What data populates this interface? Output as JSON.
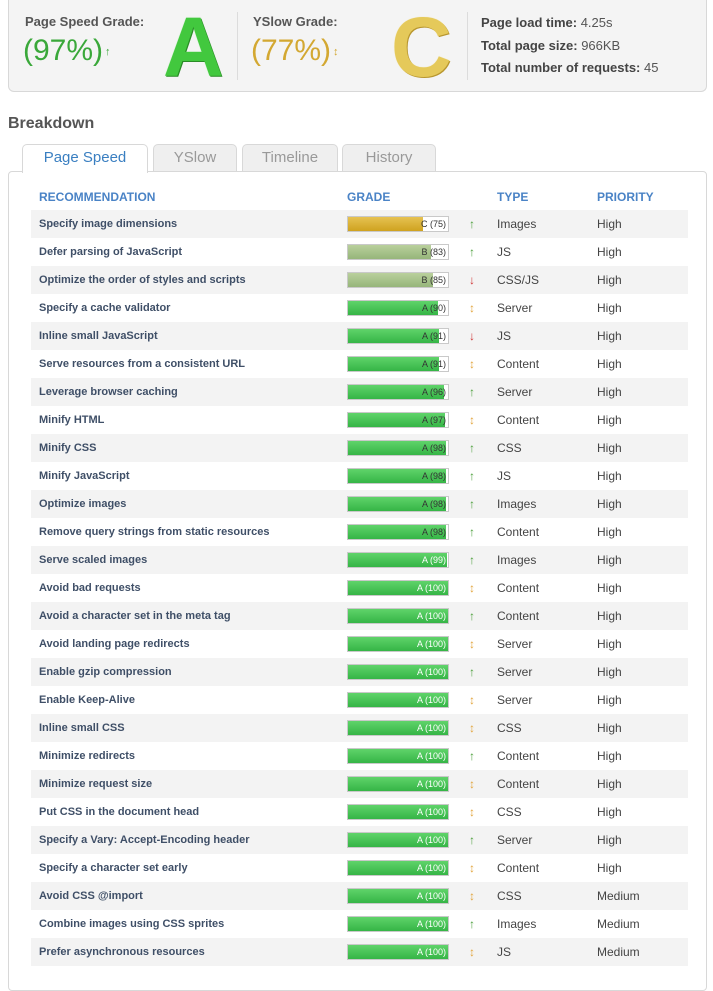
{
  "summary": {
    "pagespeed": {
      "label": "Page Speed Grade:",
      "percent": "(97%)",
      "trend": "↑",
      "letter": "A"
    },
    "yslow": {
      "label": "YSlow Grade:",
      "percent": "(77%)",
      "trend": "↕",
      "letter": "C"
    },
    "stats": [
      {
        "label": "Page load time:",
        "value": "4.25s"
      },
      {
        "label": "Total page size:",
        "value": "966KB"
      },
      {
        "label": "Total number of requests:",
        "value": "45"
      }
    ]
  },
  "breakdown": {
    "title": "Breakdown",
    "tabs": [
      "Page Speed",
      "YSlow",
      "Timeline",
      "History"
    ],
    "active_tab": 0,
    "headers": {
      "recommendation": "RECOMMENDATION",
      "grade": "GRADE",
      "type": "TYPE",
      "priority": "PRIORITY"
    },
    "rows": [
      {
        "rec": "Specify image dimensions",
        "letter": "C",
        "score": 75,
        "trend": "up",
        "type": "Images",
        "priority": "High"
      },
      {
        "rec": "Defer parsing of JavaScript",
        "letter": "B",
        "score": 83,
        "trend": "up",
        "type": "JS",
        "priority": "High"
      },
      {
        "rec": "Optimize the order of styles and scripts",
        "letter": "B",
        "score": 85,
        "trend": "down",
        "type": "CSS/JS",
        "priority": "High"
      },
      {
        "rec": "Specify a cache validator",
        "letter": "A",
        "score": 90,
        "trend": "updown",
        "type": "Server",
        "priority": "High"
      },
      {
        "rec": "Inline small JavaScript",
        "letter": "A",
        "score": 91,
        "trend": "down",
        "type": "JS",
        "priority": "High"
      },
      {
        "rec": "Serve resources from a consistent URL",
        "letter": "A",
        "score": 91,
        "trend": "updown",
        "type": "Content",
        "priority": "High"
      },
      {
        "rec": "Leverage browser caching",
        "letter": "A",
        "score": 96,
        "trend": "up",
        "type": "Server",
        "priority": "High"
      },
      {
        "rec": "Minify HTML",
        "letter": "A",
        "score": 97,
        "trend": "updown",
        "type": "Content",
        "priority": "High"
      },
      {
        "rec": "Minify CSS",
        "letter": "A",
        "score": 98,
        "trend": "up",
        "type": "CSS",
        "priority": "High"
      },
      {
        "rec": "Minify JavaScript",
        "letter": "A",
        "score": 98,
        "trend": "up",
        "type": "JS",
        "priority": "High"
      },
      {
        "rec": "Optimize images",
        "letter": "A",
        "score": 98,
        "trend": "up",
        "type": "Images",
        "priority": "High"
      },
      {
        "rec": "Remove query strings from static resources",
        "letter": "A",
        "score": 98,
        "trend": "up",
        "type": "Content",
        "priority": "High"
      },
      {
        "rec": "Serve scaled images",
        "letter": "A",
        "score": 99,
        "trend": "up",
        "type": "Images",
        "priority": "High"
      },
      {
        "rec": "Avoid bad requests",
        "letter": "A",
        "score": 100,
        "trend": "updown",
        "type": "Content",
        "priority": "High"
      },
      {
        "rec": "Avoid a character set in the meta tag",
        "letter": "A",
        "score": 100,
        "trend": "up",
        "type": "Content",
        "priority": "High"
      },
      {
        "rec": "Avoid landing page redirects",
        "letter": "A",
        "score": 100,
        "trend": "updown",
        "type": "Server",
        "priority": "High"
      },
      {
        "rec": "Enable gzip compression",
        "letter": "A",
        "score": 100,
        "trend": "up",
        "type": "Server",
        "priority": "High"
      },
      {
        "rec": "Enable Keep-Alive",
        "letter": "A",
        "score": 100,
        "trend": "updown",
        "type": "Server",
        "priority": "High"
      },
      {
        "rec": "Inline small CSS",
        "letter": "A",
        "score": 100,
        "trend": "updown",
        "type": "CSS",
        "priority": "High"
      },
      {
        "rec": "Minimize redirects",
        "letter": "A",
        "score": 100,
        "trend": "up",
        "type": "Content",
        "priority": "High"
      },
      {
        "rec": "Minimize request size",
        "letter": "A",
        "score": 100,
        "trend": "updown",
        "type": "Content",
        "priority": "High"
      },
      {
        "rec": "Put CSS in the document head",
        "letter": "A",
        "score": 100,
        "trend": "updown",
        "type": "CSS",
        "priority": "High"
      },
      {
        "rec": "Specify a Vary: Accept-Encoding header",
        "letter": "A",
        "score": 100,
        "trend": "up",
        "type": "Server",
        "priority": "High"
      },
      {
        "rec": "Specify a character set early",
        "letter": "A",
        "score": 100,
        "trend": "updown",
        "type": "Content",
        "priority": "High"
      },
      {
        "rec": "Avoid CSS @import",
        "letter": "A",
        "score": 100,
        "trend": "updown",
        "type": "CSS",
        "priority": "Medium"
      },
      {
        "rec": "Combine images using CSS sprites",
        "letter": "A",
        "score": 100,
        "trend": "up",
        "type": "Images",
        "priority": "Medium"
      },
      {
        "rec": "Prefer asynchronous resources",
        "letter": "A",
        "score": 100,
        "trend": "updown",
        "type": "JS",
        "priority": "Medium"
      }
    ]
  }
}
